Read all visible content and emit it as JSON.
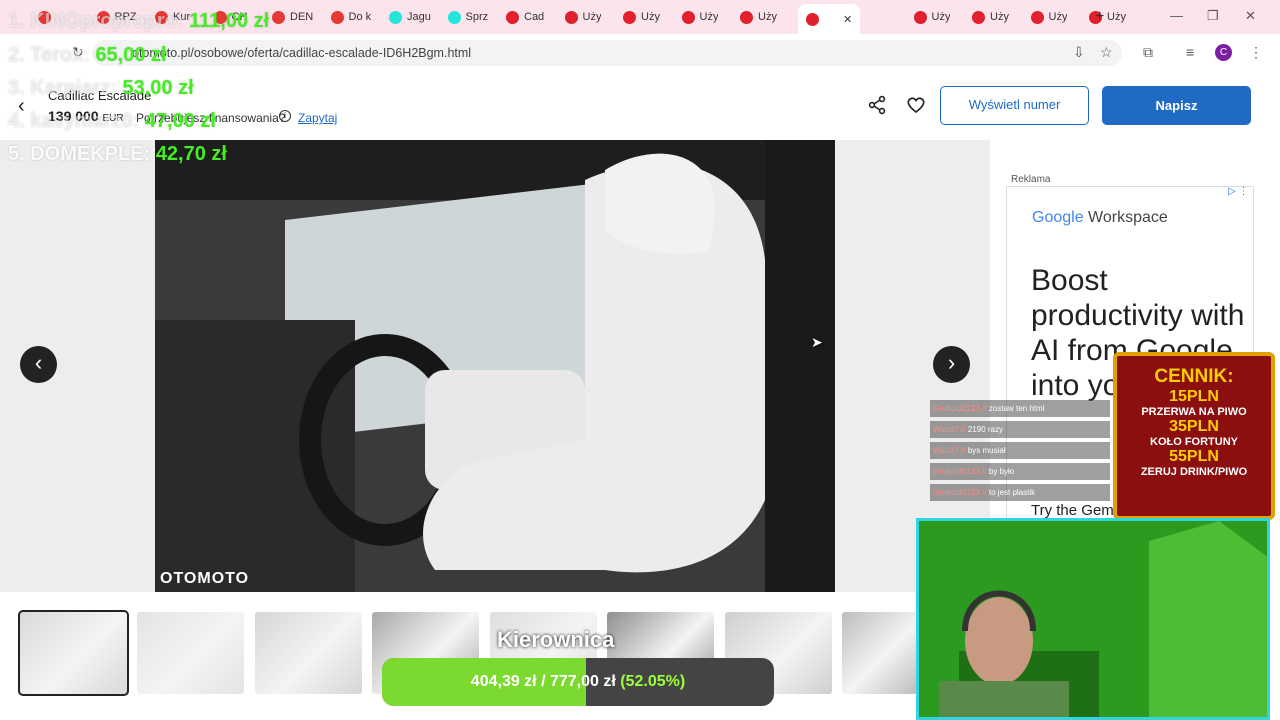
{
  "browser": {
    "tabs": [
      {
        "label": "",
        "icon": "youtube-icon",
        "color": "#e53935"
      },
      {
        "label": "RPZ",
        "icon": "youtube-icon",
        "color": "#e53935"
      },
      {
        "label": "Kur",
        "icon": "youtube-icon",
        "color": "#e53935"
      },
      {
        "label": "CH",
        "icon": "youtube-icon",
        "color": "#e53935"
      },
      {
        "label": "DEN",
        "icon": "youtube-icon",
        "color": "#e53935"
      },
      {
        "label": "Do k",
        "icon": "youtube-icon",
        "color": "#e53935"
      },
      {
        "label": "Jagu",
        "icon": "olx-icon",
        "color": "#23e5db"
      },
      {
        "label": "Sprz",
        "icon": "olx-icon",
        "color": "#23e5db"
      },
      {
        "label": "Cad",
        "icon": "otomoto-icon",
        "color": "#e0202c"
      },
      {
        "label": "Uży",
        "icon": "otomoto-icon",
        "color": "#e0202c"
      },
      {
        "label": "Uży",
        "icon": "otomoto-icon",
        "color": "#e0202c"
      },
      {
        "label": "Uży",
        "icon": "otomoto-icon",
        "color": "#e0202c"
      },
      {
        "label": "Uży",
        "icon": "otomoto-icon",
        "color": "#e0202c"
      },
      {
        "label": "",
        "icon": "otomoto-icon",
        "color": "#e0202c",
        "active": true
      },
      {
        "label": "Uży",
        "icon": "otomoto-icon",
        "color": "#e0202c"
      },
      {
        "label": "Uży",
        "icon": "otomoto-icon",
        "color": "#e0202c"
      },
      {
        "label": "Uży",
        "icon": "otomoto-icon",
        "color": "#e0202c"
      },
      {
        "label": "Uży",
        "icon": "otomoto-icon",
        "color": "#e0202c"
      }
    ],
    "new_tab": "+",
    "url": "otomoto.pl/osobowe/oferta/cadillac-escalade-ID6H2Bgm.html",
    "profile_initial": "C"
  },
  "listing": {
    "title": "Cadillac Escalade",
    "price": "139 000",
    "currency": "EUR",
    "financing_question": "Potrzebujesz finansowania?",
    "ask_link": "Zapytaj",
    "show_number": "Wyświetl numer",
    "write": "Napisz",
    "watermark": "OTOMOTO"
  },
  "ad": {
    "label": "Reklama",
    "brand_google": "Google",
    "brand_product": " Workspace",
    "headline": "Boost productivity with AI from Google into your work",
    "cta": "Try the Gemini"
  },
  "stream": {
    "leaderboard": [
      {
        "name": "1. KINGpropropro:",
        "amount": "111,00 zł"
      },
      {
        "name": "2. Terox:",
        "amount": "65,00 zł"
      },
      {
        "name": "3. Karpiarz:",
        "amount": "53,00 zł"
      },
      {
        "name": "4. kasyniarz0:",
        "amount": "47,00 zł"
      },
      {
        "name": "5. DOMEKPLE:",
        "amount": "42,70 zł"
      }
    ],
    "chat": [
      {
        "user": "Grubciol1123 //",
        "msg": "zostaw ten html"
      },
      {
        "user": "Walcz7 //",
        "msg": "2190 razy"
      },
      {
        "user": "Walcz7 //",
        "msg": "bys musiał"
      },
      {
        "user": "Grubciol1123 //",
        "msg": "by było"
      },
      {
        "user": "Grubciol1123 //",
        "msg": "to jest plastik"
      }
    ],
    "cennik": {
      "title": "CENNIK:",
      "items": [
        {
          "price": "15PLN",
          "desc": "PRZERWA NA PIWO"
        },
        {
          "price": "35PLN",
          "desc": "KOŁO FORTUNY"
        },
        {
          "price": "55PLN",
          "desc": "ZERUJ DRINK/PIWO"
        }
      ]
    },
    "goal": {
      "title": "Kierownica",
      "current": "404,39 zł",
      "separator": "/",
      "target": "777,00 zł",
      "percent_label": "(52.05%)",
      "fraction": 0.5205
    }
  }
}
